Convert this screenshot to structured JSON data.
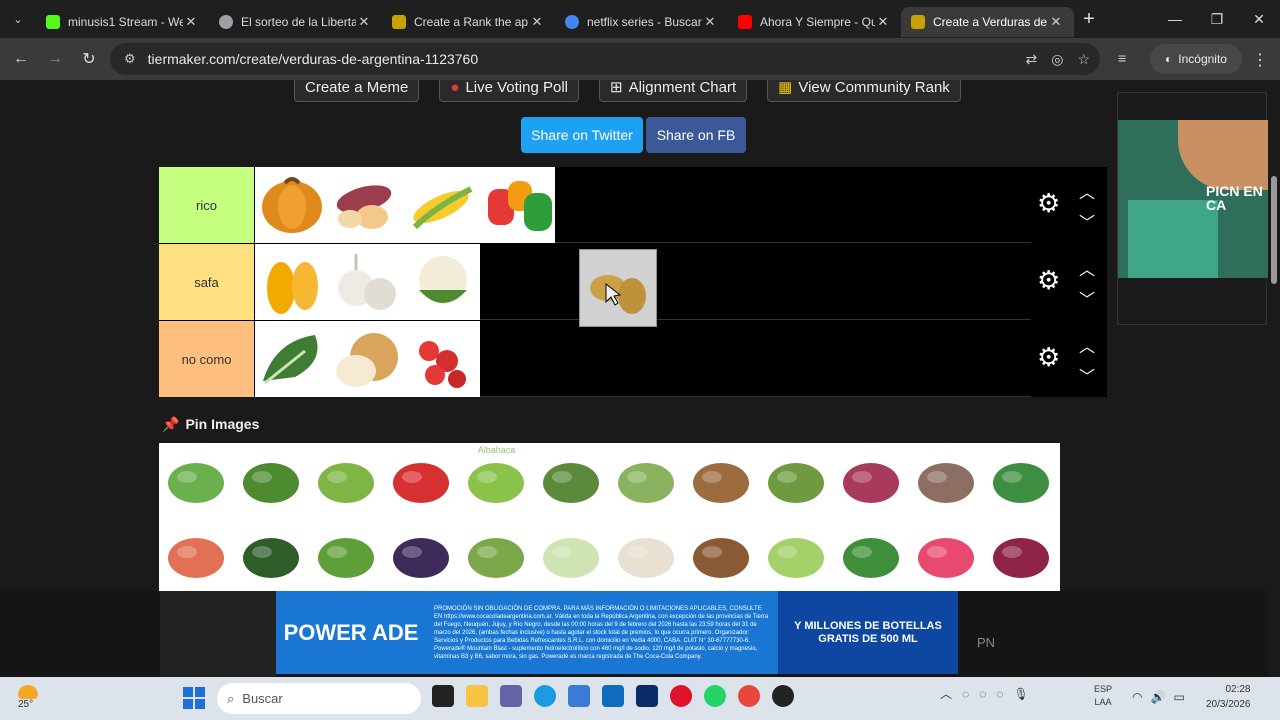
{
  "browser": {
    "tabs": [
      {
        "title": "minusis1 Stream - We",
        "color": "#53fc18"
      },
      {
        "title": "El sorteo de la Liberta",
        "color": "#9aa0a6"
      },
      {
        "title": "Create a Rank the ap",
        "color": "#c8a200"
      },
      {
        "title": "netflix series - Buscar",
        "color": "#4285f4"
      },
      {
        "title": "Ahora Y Siempre - Qu",
        "color": "#ff0000"
      },
      {
        "title": "Create a Verduras de",
        "color": "#c8a200"
      }
    ],
    "url": "tiermaker.com/create/verduras-de-argentina-1123760",
    "profile": "Incógnito"
  },
  "page": {
    "top_buttons": [
      "Create a Meme",
      "Live Voting Poll",
      "Alignment Chart",
      "View Community Rank"
    ],
    "share_twitter": "Share on Twitter",
    "share_fb": "Share on FB",
    "pin_images": "Pin Images",
    "tiers": [
      {
        "label": "rico",
        "color": "#c6ff7f",
        "items": [
          "pumpkin",
          "sweet-potato",
          "corn",
          "bell-peppers"
        ]
      },
      {
        "label": "safa",
        "color": "#ffdf80",
        "items": [
          "butternut-squash",
          "garlic",
          "cauliflower"
        ]
      },
      {
        "label": "no como",
        "color": "#ffbf7f",
        "items": [
          "kale",
          "onion",
          "cherry-tomatoes"
        ]
      }
    ],
    "dragging_item": "potatoes",
    "pool_items": [
      "peas",
      "green-beans",
      "celery",
      "red-chili",
      "basil",
      "leek",
      "brussels-sprouts",
      "yuca",
      "green-onion",
      "red-onion",
      "mushroom",
      "spinach",
      "sweet-potato-orange",
      "avocado",
      "arugula",
      "eggplant",
      "asparagus",
      "fennel",
      "sprouts",
      "yam",
      "cabbage",
      "parsley",
      "radish",
      "beets"
    ],
    "basil_caption": "Albahaca",
    "pool_colors": [
      "#6ab04c",
      "#4e8a2f",
      "#7fb545",
      "#d63031",
      "#8bc34a",
      "#5d8a3a",
      "#8ab35f",
      "#9c6b3e",
      "#6e9b3f",
      "#a83a5b",
      "#8d6e63",
      "#3e8e41",
      "#e17055",
      "#2f5d2a",
      "#5f9f3a",
      "#3d2c5a",
      "#7da84a",
      "#cfe3b3",
      "#e8e0d0",
      "#8a5a35",
      "#a5d16a",
      "#3f8f3a",
      "#e84a6f",
      "#8e2548"
    ],
    "ad": {
      "brand": "POWER ADE",
      "legal": "PROMOCIÓN SIN OBLIGACIÓN DE COMPRA. PARA MÁS INFORMACIÓN O LIMITACIONES APLICABLES, CONSULTE EN https://www.cocacoladeargentina.com.ar. Válida en toda la República Argentina, con excepción de las provincias de Tierra del Fuego, Neuquén, Jujuy, y Río Negro, desde las 00:00 horas del 9 de febrero del 2026 hasta las 23:59 horas del 31 de marzo del 2026, (ambas fechas inclusive) o hasta agotar el stock total de premios, lo que ocurra primero. Organizador: Servicios y Productos para Bebidas Refrescantes S.R.L. con domicilio en Vedia 4000, CABA. CUIT N° 30-67777730-6. Powerade® Mountain Blast - suplemento hidroelectrolítico con 460 mg/l de sodio, 120 mg/l de potasio, calcio y magnesio, vitaminas B3 y B6, sabor mora, sin gas. Powerade es marca registrada de The Coca-Cola Company.",
      "promo": "Y MILLONES DE BOTELLAS GRATIS DE 500 ML",
      "pn": "PN"
    },
    "side_ad_text": "PICN EN CA"
  },
  "taskbar": {
    "weather": "25°",
    "search": "Buscar",
    "lang": [
      "ESP",
      "LAA"
    ],
    "time": "02:28",
    "date": "20/3/2026"
  },
  "colors": {
    "twitter": "#1da1f2",
    "facebook": "#3b5998",
    "powerade": "#1976d2"
  }
}
